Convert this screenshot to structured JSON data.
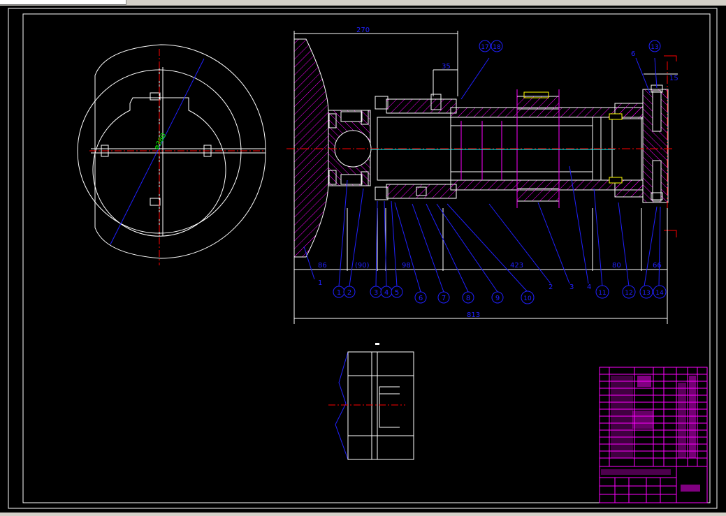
{
  "drawing": {
    "dims": {
      "d270": "270",
      "d35": "35",
      "d15": "15",
      "d86": "86",
      "d90": "(90)",
      "d98": "98",
      "d423": "423",
      "d80": "80",
      "d66": "66",
      "d813": "813"
    },
    "side_view": {
      "diameter": "ø380"
    },
    "balloons": [
      "1",
      "2",
      "3",
      "4",
      "5",
      "6",
      "7",
      "8",
      "9",
      "10",
      "11",
      "12",
      "13",
      "14"
    ],
    "flat_labels": {
      "l1": "1",
      "l2": "2",
      "l3": "3",
      "l4": "4",
      "l6": "6"
    },
    "top_balloons": {
      "b17": "17",
      "b18": "18",
      "b13": "13"
    },
    "colors": {
      "outline": "#ffffff",
      "hatch": "#ff00ff",
      "center": "#ff0000",
      "dimension": "#2020ff",
      "rod": "#00ffff",
      "yellow": "#ffff00",
      "green": "#00ff00",
      "table": "#ff00ff"
    }
  }
}
